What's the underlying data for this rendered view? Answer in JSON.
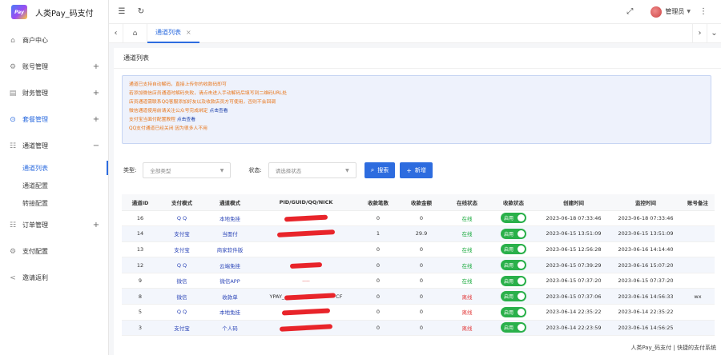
{
  "app": {
    "title": "人类Pay_码支付",
    "logo_text": "Pay"
  },
  "sidebar": {
    "items": [
      {
        "label": "商户中心",
        "toggle": ""
      },
      {
        "label": "账号管理",
        "toggle": "+"
      },
      {
        "label": "财务管理",
        "toggle": "+"
      },
      {
        "label": "套餐管理",
        "toggle": "+"
      },
      {
        "label": "通道管理",
        "toggle": "−"
      },
      {
        "label": "订单管理",
        "toggle": "+"
      },
      {
        "label": "支付配置",
        "toggle": ""
      },
      {
        "label": "邀请返利",
        "toggle": ""
      }
    ],
    "subitems": [
      {
        "label": "通道列表"
      },
      {
        "label": "通道配置"
      },
      {
        "label": "转接配置"
      }
    ]
  },
  "header": {
    "user": "管理员"
  },
  "tabs": {
    "active": "通道列表",
    "close": "×"
  },
  "card": {
    "title": "通道列表"
  },
  "notice": {
    "lines": [
      {
        "text": "通道已支持自动解码，直接上传你的收款码即可",
        "link": ""
      },
      {
        "text": "若添加微信店员通道时解码失败，请点击进入手动解码后填写到二维码URL处",
        "link": ""
      },
      {
        "text": "店员通道需联系QQ客服添加好友以及收款店员方可使用，否则不会回调",
        "link": ""
      },
      {
        "text": "微信通道使用前请关注公众号完成绑定",
        "link": "点击查看"
      },
      {
        "text": "支付宝当面付配置教程",
        "link": "点击查看"
      },
      {
        "text": "QQ支付通道已经关闭 因为很多人不用",
        "link": ""
      }
    ]
  },
  "filters": {
    "type_label": "类型:",
    "type_value": "全部类型",
    "status_label": "状态:",
    "status_value": "请选择状态",
    "search_label": "搜索",
    "add_label": "新增"
  },
  "table": {
    "columns": [
      "通道ID",
      "支付模式",
      "通道模式",
      "PID/GUID/QQ/NICK",
      "收款笔数",
      "收款金额",
      "在线状态",
      "收款状态",
      "创建时间",
      "监控时间",
      "账号备注"
    ],
    "switch_label": "启用",
    "rows": [
      {
        "id": "16",
        "pay": "Q Q",
        "mode": "本地免挂",
        "pid": "",
        "count": "0",
        "amount": "0",
        "online": "在线",
        "created": "2023-06-18 07:33:46",
        "monitor": "2023-06-18 07:33:46",
        "note": ""
      },
      {
        "id": "14",
        "pay": "支付宝",
        "mode": "当面付",
        "pid": "",
        "count": "1",
        "amount": "29.9",
        "online": "在线",
        "created": "2023-06-15 13:51:09",
        "monitor": "2023-06-15 13:51:09",
        "note": ""
      },
      {
        "id": "13",
        "pay": "支付宝",
        "mode": "商家软件版",
        "pid": "",
        "count": "0",
        "amount": "0",
        "online": "在线",
        "created": "2023-06-15 12:56:28",
        "monitor": "2023-06-16 14:14:40",
        "note": ""
      },
      {
        "id": "12",
        "pay": "Q Q",
        "mode": "云端免挂",
        "pid": "",
        "count": "0",
        "amount": "0",
        "online": "在线",
        "created": "2023-06-15 07:39:29",
        "monitor": "2023-06-16 15:07:20",
        "note": ""
      },
      {
        "id": "9",
        "pay": "微信",
        "mode": "微信APP",
        "pid": "----",
        "count": "0",
        "amount": "0",
        "online": "在线",
        "created": "2023-06-15 07:37:20",
        "monitor": "2023-06-15 07:37:20",
        "note": ""
      },
      {
        "id": "8",
        "pay": "微信",
        "mode": "收款单",
        "pid": "YPAY_",
        "pid_suffix": "CF",
        "count": "0",
        "amount": "0",
        "online": "离线",
        "created": "2023-06-15 07:37:06",
        "monitor": "2023-06-16 14:56:33",
        "note": "wx"
      },
      {
        "id": "5",
        "pay": "Q Q",
        "mode": "本地免挂",
        "pid": "",
        "count": "0",
        "amount": "0",
        "online": "离线",
        "created": "2023-06-14 22:35:22",
        "monitor": "2023-06-14 22:35:22",
        "note": ""
      },
      {
        "id": "3",
        "pay": "支付宝",
        "mode": "个人码",
        "pid": "",
        "count": "0",
        "amount": "0",
        "online": "离线",
        "created": "2023-06-14 22:23:59",
        "monitor": "2023-06-16 14:56:25",
        "note": ""
      }
    ]
  },
  "footer": {
    "text": "人类Pay_码支付 | 快捷的支付系统"
  }
}
